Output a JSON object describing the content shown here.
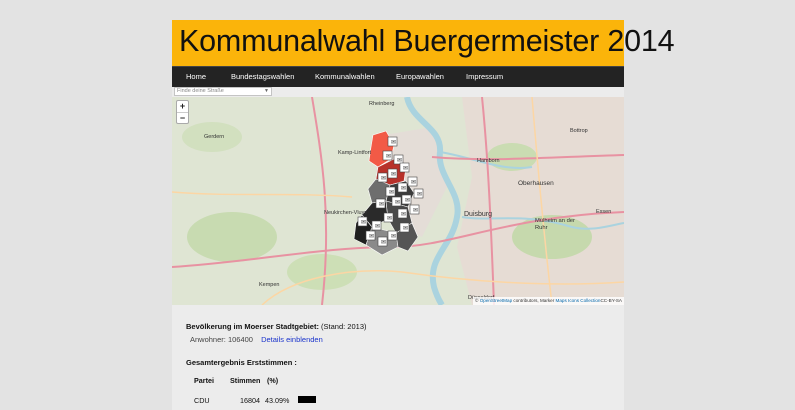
{
  "header": {
    "title": "Kommunalwahl Buergermeister 2014",
    "color": "#fbb40a"
  },
  "nav": {
    "items": [
      {
        "label": "Home"
      },
      {
        "label": "Bundestagswahlen"
      },
      {
        "label": "Kommunalwahlen"
      },
      {
        "label": "Europawahlen"
      },
      {
        "label": "Impressum"
      }
    ]
  },
  "search": {
    "placeholder": "Finde deine Straße"
  },
  "map": {
    "zoom_in": "+",
    "zoom_out": "−",
    "attribution": {
      "copyright": "©",
      "osm": "OpenStreetMap",
      "contributors": " contributors, Marker ",
      "maps_icons": "Maps Icons Collection",
      "license": "CC-BY-SA"
    },
    "places": [
      "Rheinberg",
      "Kamp-Lintfort",
      "Gerdern",
      "Neukirchen-Vluyn",
      "Kempen",
      "Bottrop",
      "Hamborn",
      "Oberhausen",
      "Duisburg",
      "Mülheim an der Ruhr",
      "Essen",
      "Düsseldorf"
    ]
  },
  "stats": {
    "population_label": "Bevölkerung im Moerser Stadtgebiet:",
    "population_note": "(Stand: 2013)",
    "inhabitants": "Anwohner: 106400",
    "details_link": "Details einblenden"
  },
  "results": {
    "title": "Gesamtergebnis Erststimmen :",
    "headers": [
      "Partei",
      "Stimmen",
      "(%)"
    ],
    "rows": [
      {
        "party": "CDU",
        "votes": "16804",
        "percent": "43.09%",
        "share": 0.4309
      }
    ]
  }
}
